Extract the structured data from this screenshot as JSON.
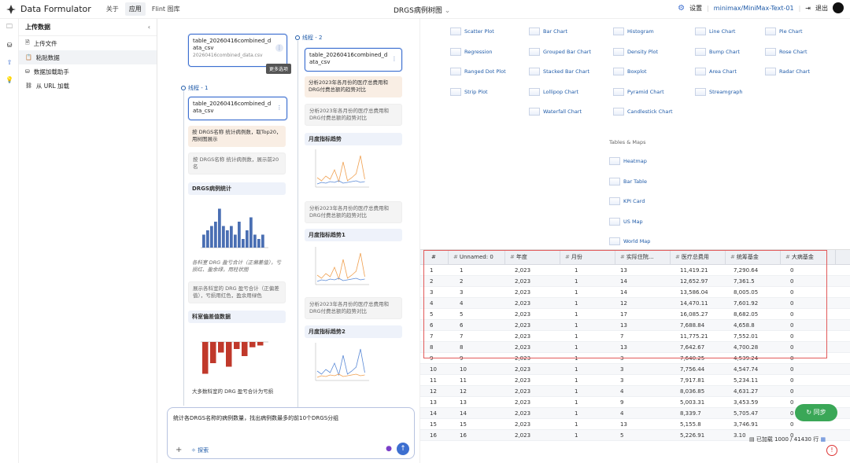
{
  "header": {
    "app_title": "Data Formulator",
    "nav": [
      "关于",
      "应用",
      "Flint 图库"
    ],
    "active_nav": 1,
    "center_title": "DRGS病例树图",
    "settings_label": "设置",
    "model": "minimax/MiniMax-Text-01",
    "logout_label": "退出"
  },
  "sidebar": {
    "title": "上传数据",
    "items": [
      "上传文件",
      "粘贴数据",
      "数据加载助手",
      "从 URL 加载"
    ],
    "active": 1
  },
  "threads": {
    "thread1_label": "线程 - 1",
    "thread2_label": "线程 - 2",
    "top_card": {
      "title": "table_20260416combined_data_csv",
      "subtitle": "20260416combined_data.csv"
    },
    "tooltip": "更多选项",
    "col1": [
      {
        "type": "card",
        "text": "table_20260416combined_data_csv"
      },
      {
        "type": "user",
        "text": "按 DRGS名称 统计病例数，取Top20，用树图展示"
      },
      {
        "type": "agent",
        "text": "按 DRGS名称 统计病例数，展示前20名"
      },
      {
        "type": "chart",
        "text": "DRGS病例统计"
      },
      {
        "type": "note",
        "text": "各科室 DRG 盈亏合计（正偏差值），亏损红、盈余绿，用柱状图"
      },
      {
        "type": "agent",
        "text": "展示各科室的 DRG 盈亏合计（正偏差值），亏损用红色，盈余用绿色"
      },
      {
        "type": "chart",
        "text": "科室偏差值数据"
      },
      {
        "type": "agent",
        "text": "大多数科室的 DRG 盈亏合计为亏损"
      }
    ],
    "col2": [
      {
        "type": "card",
        "text": "table_20260416combined_data_csv"
      },
      {
        "type": "user",
        "text": "分析2023年各月份的医疗总费用和DRG付费总额的趋势对比"
      },
      {
        "type": "agent",
        "text": "分析2023年各月份的医疗总费用和DRG付费总额的趋势对比"
      },
      {
        "type": "chart",
        "text": "月度指标趋势"
      },
      {
        "type": "agent",
        "text": "分析2023年各月份的医疗总费用和DRG付费总额的趋势对比"
      },
      {
        "type": "chart",
        "text": "月度指标趋势1"
      },
      {
        "type": "agent",
        "text": "分析2023年各月份的医疗总费用和DRG付费总额的趋势对比"
      },
      {
        "type": "chart",
        "text": "月度指标趋势2"
      }
    ]
  },
  "prompt": {
    "text": "统计各DRGS名称的病例数量，找出病例数最多的前10个DRGS分组",
    "explore_label": "探索"
  },
  "chart_types": {
    "col1": [
      "Scatter Plot",
      "Regression",
      "Ranged Dot Plot",
      "Strip Plot"
    ],
    "col2": [
      "Bar Chart",
      "Grouped Bar Chart",
      "Stacked Bar Chart",
      "Lollipop Chart",
      "Waterfall Chart"
    ],
    "col3": [
      "Histogram",
      "Density Plot",
      "Boxplot",
      "Pyramid Chart",
      "Candlestick Chart"
    ],
    "col4": [
      "Line Chart",
      "Bump Chart",
      "Area Chart",
      "Streamgraph"
    ],
    "col5": [
      "Pie Chart",
      "Rose Chart",
      "Radar Chart"
    ],
    "tables_maps_label": "Tables & Maps",
    "tables_maps": [
      "Heatmap",
      "Bar Table",
      "KPI Card",
      "US Map",
      "World Map"
    ]
  },
  "table": {
    "columns": [
      "#",
      "Unnamed: 0",
      "年度",
      "月份",
      "实际住院...",
      "医疗总费用",
      "统筹基金",
      "大病基金"
    ],
    "rows": [
      [
        "1",
        "1",
        "2,023",
        "1",
        "13",
        "11,419.21",
        "7,290.64",
        "0"
      ],
      [
        "2",
        "2",
        "2,023",
        "1",
        "14",
        "12,652.97",
        "7,361.5",
        "0"
      ],
      [
        "3",
        "3",
        "2,023",
        "1",
        "14",
        "13,586.04",
        "8,005.05",
        "0"
      ],
      [
        "4",
        "4",
        "2,023",
        "1",
        "12",
        "14,470.11",
        "7,601.92",
        "0"
      ],
      [
        "5",
        "5",
        "2,023",
        "1",
        "17",
        "16,085.27",
        "8,682.05",
        "0"
      ],
      [
        "6",
        "6",
        "2,023",
        "1",
        "13",
        "7,688.84",
        "4,658.8",
        "0"
      ],
      [
        "7",
        "7",
        "2,023",
        "1",
        "7",
        "11,775.21",
        "7,552.01",
        "0"
      ],
      [
        "8",
        "8",
        "2,023",
        "1",
        "13",
        "7,642.67",
        "4,700.28",
        "0"
      ],
      [
        "9",
        "9",
        "2,023",
        "1",
        "3",
        "7,640.25",
        "4,539.24",
        "0"
      ],
      [
        "10",
        "10",
        "2,023",
        "1",
        "3",
        "7,756.44",
        "4,547.74",
        "0"
      ],
      [
        "11",
        "11",
        "2,023",
        "1",
        "3",
        "7,917.81",
        "5,234.11",
        "0"
      ],
      [
        "12",
        "12",
        "2,023",
        "1",
        "4",
        "8,036.85",
        "4,631.27",
        "0"
      ],
      [
        "13",
        "13",
        "2,023",
        "1",
        "9",
        "5,003.31",
        "3,453.59",
        "0"
      ],
      [
        "14",
        "14",
        "2,023",
        "1",
        "4",
        "8,339.7",
        "5,705.47",
        "0"
      ],
      [
        "15",
        "15",
        "2,023",
        "1",
        "13",
        "5,155.8",
        "3,746.91",
        "0"
      ],
      [
        "16",
        "16",
        "2,023",
        "1",
        "5",
        "5,226.91",
        "3.10",
        "0"
      ]
    ],
    "loaded_label": "已加载 1000 / 41430 行",
    "sync_label": "同步"
  },
  "colors": {
    "accent": "#3d6fd0",
    "select_box": "#e25a5a",
    "sync": "#3aa757",
    "user_msg": "#f9eee4"
  }
}
